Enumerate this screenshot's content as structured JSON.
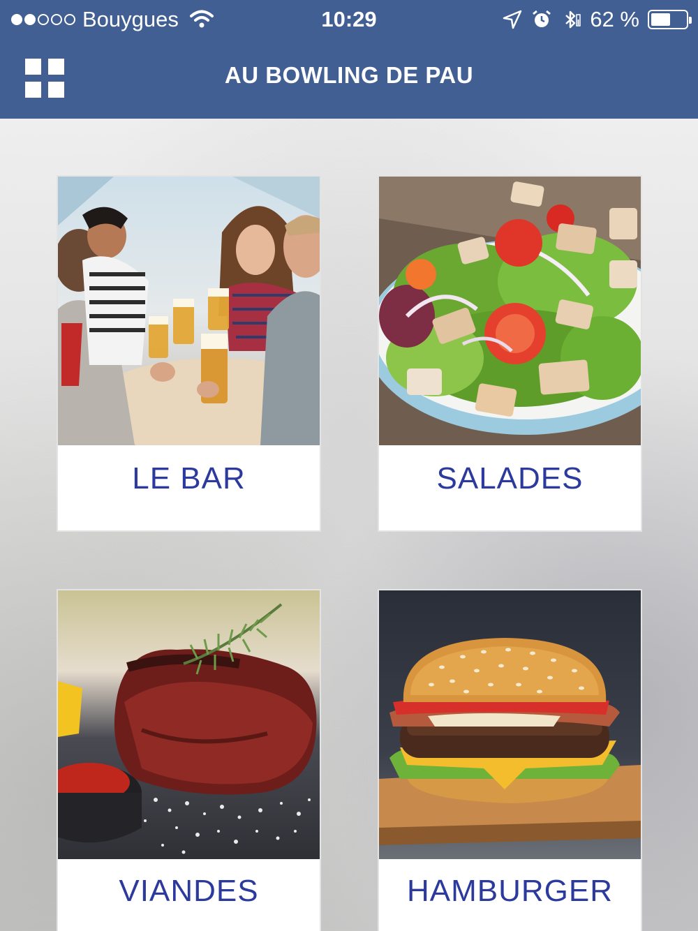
{
  "status_bar": {
    "carrier": "Bouygues",
    "time": "10:29",
    "battery": "62 %",
    "battery_level": 0.62,
    "signal_bars_filled": 2,
    "signal_bars_total": 5
  },
  "nav": {
    "title": "AU BOWLING DE PAU",
    "menu_icon": "grid-icon"
  },
  "colors": {
    "header_bg": "#425f94",
    "label_text": "#2b3a9c"
  },
  "cards": [
    {
      "label": "LE BAR",
      "image": "friends-toasting-beer-photo"
    },
    {
      "label": "SALADES",
      "image": "chicken-salad-photo"
    },
    {
      "label": "VIANDES",
      "image": "grilled-steak-photo"
    },
    {
      "label": "HAMBURGER",
      "image": "burger-photo"
    }
  ]
}
